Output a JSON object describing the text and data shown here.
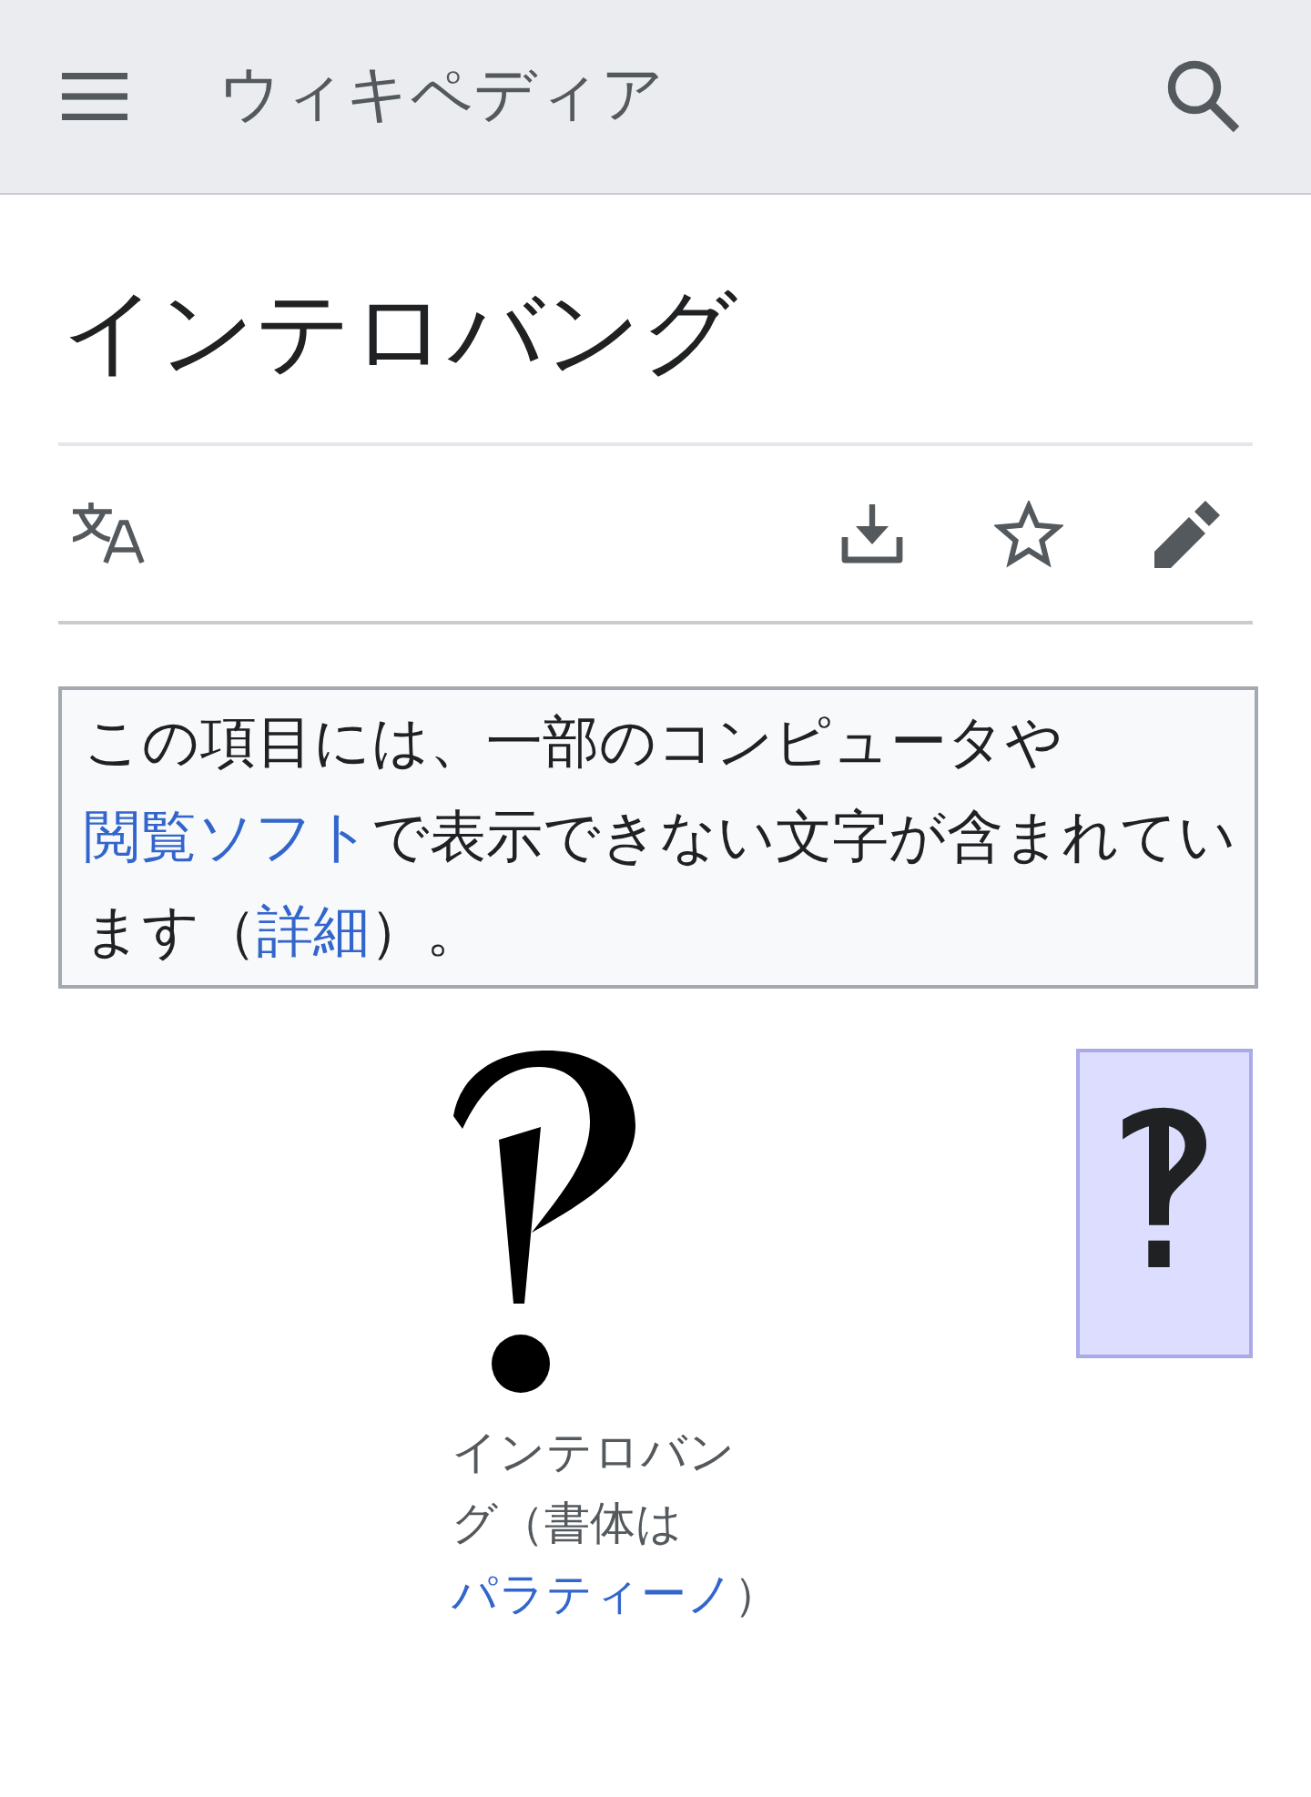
{
  "header": {
    "title": "ウィキペディア"
  },
  "page": {
    "title": "インテロバング"
  },
  "notice": {
    "segments": [
      {
        "kind": "text",
        "text": "この項目には、一部のコンピュータや"
      },
      {
        "kind": "link",
        "text": "閲覧ソフト"
      },
      {
        "kind": "text",
        "text": "で表示できない文字が含まれています（"
      },
      {
        "kind": "link",
        "text": "詳細"
      },
      {
        "kind": "text",
        "text": "）。"
      }
    ]
  },
  "figure": {
    "caption": [
      {
        "kind": "text",
        "text": "インテロバング（書体は"
      },
      {
        "kind": "link",
        "text": "パラティーノ"
      },
      {
        "kind": "text",
        "text": "）"
      }
    ]
  },
  "character_box": {
    "glyph": "‽"
  }
}
